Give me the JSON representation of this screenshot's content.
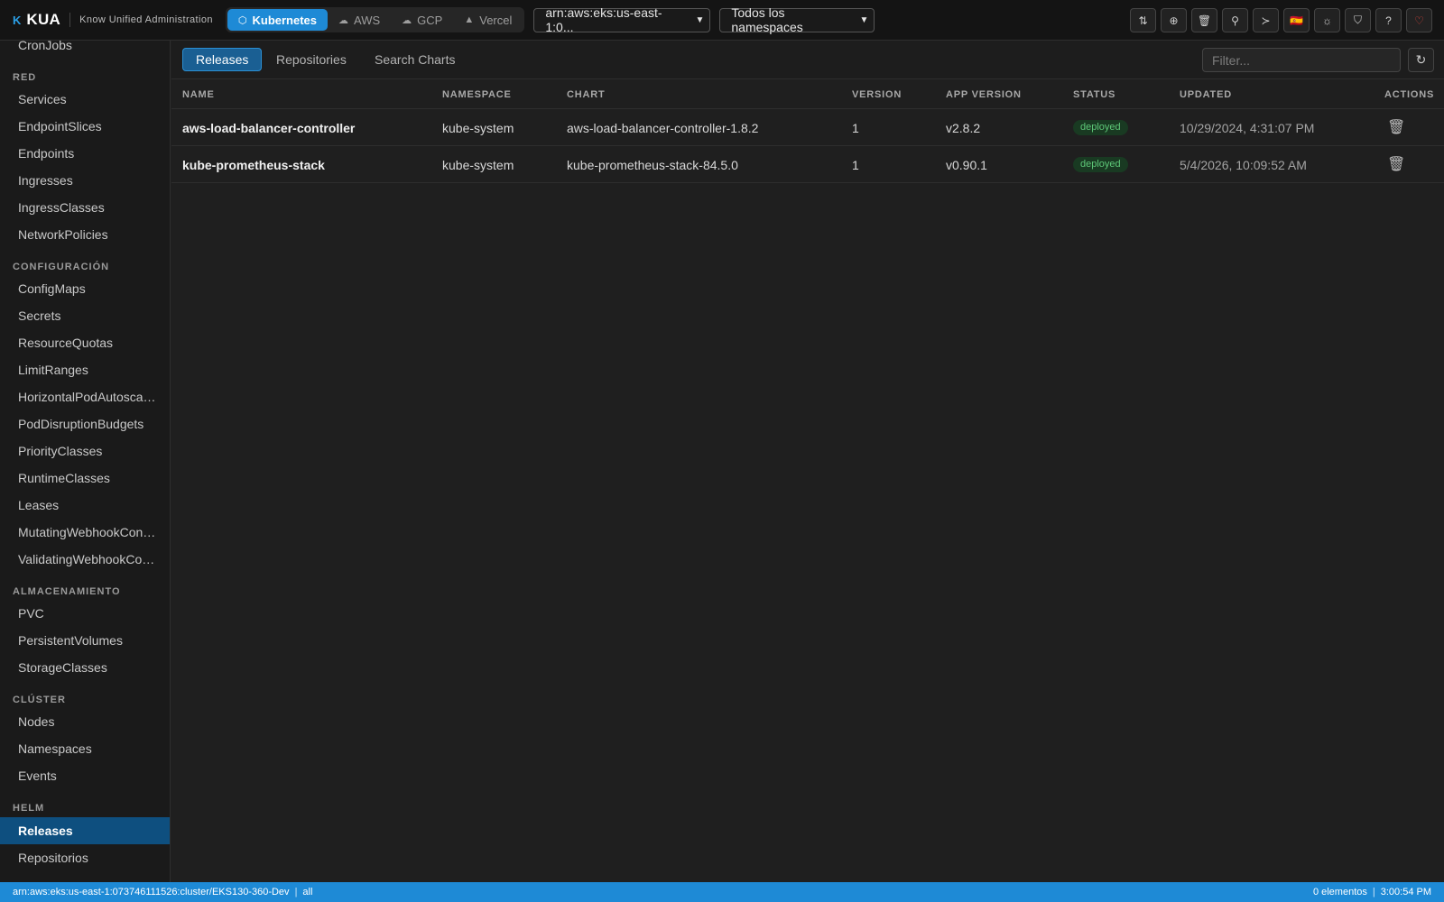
{
  "header": {
    "logo": "K",
    "app_name": "KUA",
    "app_subtitle": "Know Unified Administration",
    "providers": [
      {
        "label": "Kubernetes",
        "icon": "⬡"
      },
      {
        "label": "AWS",
        "icon": "☁"
      },
      {
        "label": "GCP",
        "icon": "☁"
      },
      {
        "label": "Vercel",
        "icon": "▲"
      }
    ],
    "cluster_select": "arn:aws:eks:us-east-1:0...",
    "namespace_select": "Todos los namespaces",
    "tools": [
      "⇅",
      "⊕",
      "🗑",
      "⚲",
      "≻",
      "🇪🇸",
      "☼",
      "⛉",
      "?",
      "♡"
    ]
  },
  "sidebar": {
    "items": [
      "CronJobs",
      "Services",
      "EndpointSlices",
      "Endpoints",
      "Ingresses",
      "IngressClasses",
      "NetworkPolicies",
      "ConfigMaps",
      "Secrets",
      "ResourceQuotas",
      "LimitRanges",
      "HorizontalPodAutoscal...",
      "PodDisruptionBudgets",
      "PriorityClasses",
      "RuntimeClasses",
      "Leases",
      "MutatingWebhookConfi...",
      "ValidatingWebhookCon...",
      "PVC",
      "PersistentVolumes",
      "StorageClasses",
      "Nodes",
      "Namespaces",
      "Events",
      "Releases",
      "Repositorios"
    ],
    "sections": [
      "RED",
      "CONFIGURACIÓN",
      "ALMACENAMIENTO",
      "CLÚSTER",
      "HELM"
    ]
  },
  "main": {
    "tabs": [
      "Releases",
      "Repositories",
      "Search Charts"
    ],
    "filter_placeholder": "Filter...",
    "refresh_icon": "↻",
    "columns": [
      "NAME",
      "NAMESPACE",
      "CHART",
      "VERSION",
      "APP VERSION",
      "STATUS",
      "UPDATED",
      "ACTIONS"
    ],
    "rows": [
      {
        "name": "aws-load-balancer-controller",
        "namespace": "kube-system",
        "chart": "aws-load-balancer-controller-1.8.2",
        "version": "1",
        "app_version": "v2.8.2",
        "status": "deployed",
        "updated": "10/29/2024, 4:31:07 PM"
      },
      {
        "name": "kube-prometheus-stack",
        "namespace": "kube-system",
        "chart": "kube-prometheus-stack-84.5.0",
        "version": "1",
        "app_version": "v0.90.1",
        "status": "deployed",
        "updated": "5/4/2026, 10:09:52 AM"
      }
    ],
    "delete_icon": "🗑"
  },
  "statusbar": {
    "context": "arn:aws:eks:us-east-1:073746111526:cluster/EKS130-360-Dev",
    "namespace": "all",
    "count": "0 elementos",
    "time": "3:00:54 PM"
  },
  "colors": {
    "accent": "#1e8ad6",
    "active_sidebar": "#0e4f7f",
    "status_deployed": "#5ec878"
  }
}
